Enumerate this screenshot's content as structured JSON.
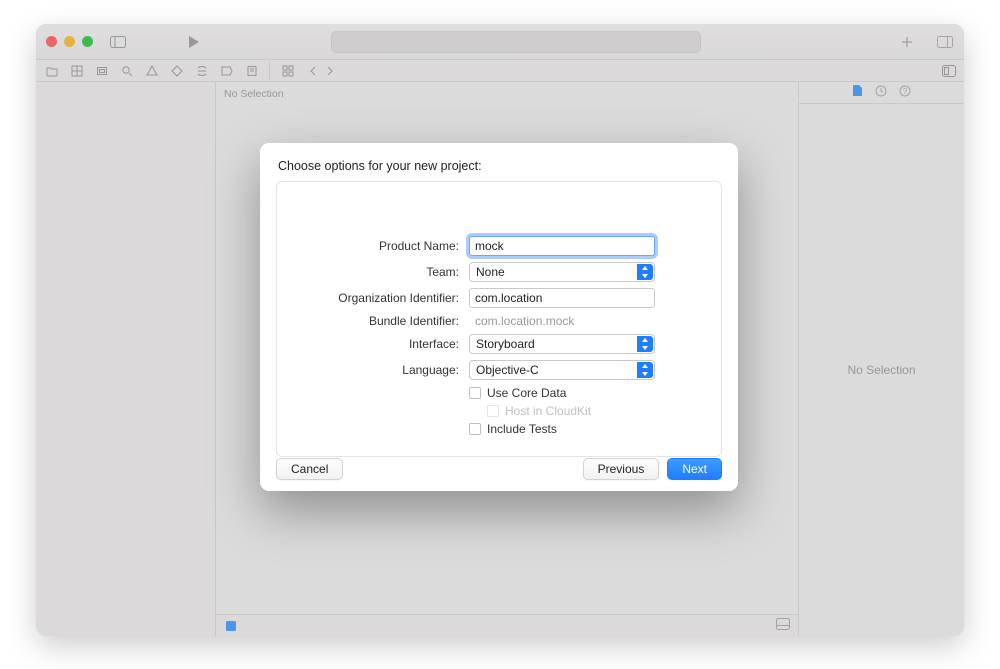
{
  "window": {
    "editor_no_selection": "No Selection",
    "inspector_no_selection": "No Selection"
  },
  "sheet": {
    "title": "Choose options for your new project:",
    "labels": {
      "product_name": "Product Name:",
      "team": "Team:",
      "org_id": "Organization Identifier:",
      "bundle_id": "Bundle Identifier:",
      "interface": "Interface:",
      "language": "Language:"
    },
    "values": {
      "product_name": "mock",
      "team": "None",
      "org_id": "com.location",
      "bundle_id": "com.location.mock",
      "interface": "Storyboard",
      "language": "Objective-C"
    },
    "checks": {
      "core_data": "Use Core Data",
      "cloudkit": "Host in CloudKit",
      "tests": "Include Tests"
    },
    "buttons": {
      "cancel": "Cancel",
      "previous": "Previous",
      "next": "Next"
    }
  }
}
